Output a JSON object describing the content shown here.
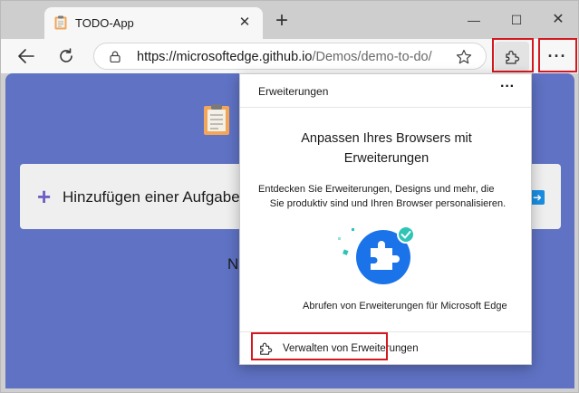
{
  "tab": {
    "title": "TODO-App",
    "close_glyph": "✕"
  },
  "window_controls": {
    "minimize": "—",
    "maximize": "☐",
    "close": "✕"
  },
  "toolbar": {
    "url_host": "https://microsoftedge.github.io",
    "url_path": "/Demos/demo-to-do/",
    "more_glyph": "···"
  },
  "page": {
    "add_task_label": "Hinzufügen einer Aufgabe",
    "partial_text": "N"
  },
  "extensions_popup": {
    "title": "Erweiterungen",
    "more_glyph": "···",
    "heading_line1": "Anpassen Ihres Browsers mit",
    "heading_line2": "Erweiterungen",
    "desc_line1": "Entdecken Sie Erweiterungen, Designs und mehr, die",
    "desc_line2": "Sie produktiv sind und Ihren Browser personalisieren.",
    "get_extensions_link": "Abrufen von Erweiterungen für Microsoft Edge",
    "manage_extensions": "Verwalten von Erweiterungen"
  },
  "colors": {
    "page_bg": "#5f72c4",
    "accent_purple": "#6f5ec4",
    "highlight_red": "#d4181f",
    "puzzle_blue": "#1a73e8"
  },
  "icons": [
    "clipboard-icon",
    "close-icon",
    "new-tab-icon",
    "minimize-icon",
    "maximize-icon",
    "back-icon",
    "refresh-icon",
    "lock-icon",
    "favorite-star-icon",
    "extensions-puzzle-icon",
    "more-options-icon",
    "plus-icon",
    "send-icon",
    "puzzle-illustration-icon",
    "manage-extensions-icon"
  ]
}
